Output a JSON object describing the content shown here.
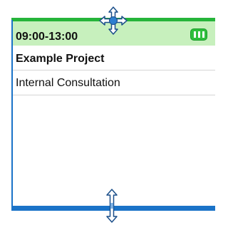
{
  "appointment": {
    "time_range": "09:00-13:00",
    "project": "Example Project",
    "activity": "Internal Consultation",
    "status_icon": "status-tag-icon"
  },
  "cursors": {
    "move": "move-cursor-icon",
    "resize": "vertical-resize-cursor-icon"
  },
  "colors": {
    "header_bg": "#c7f0bd",
    "top_border": "#26b43a",
    "side_border": "#1a73c8",
    "bottom_bar": "#1a73c8",
    "tag": "#2fbf3d"
  }
}
